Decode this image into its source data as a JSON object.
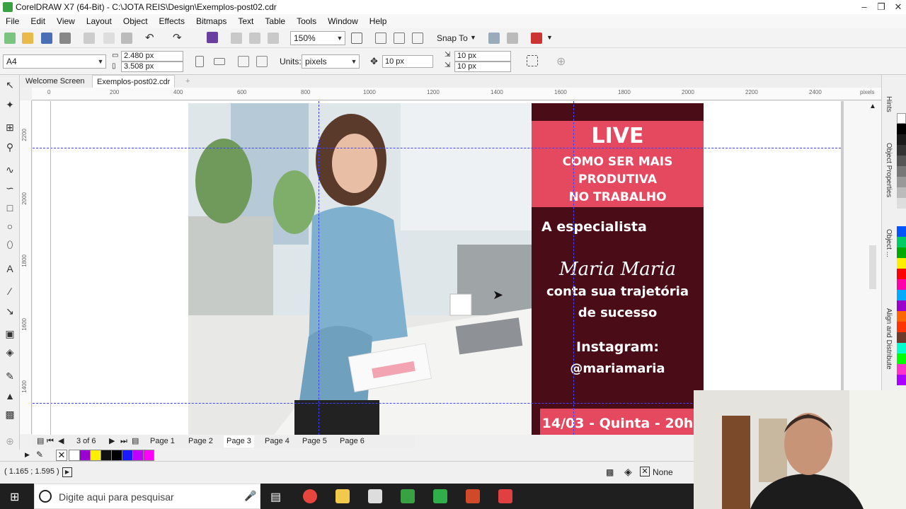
{
  "window": {
    "title": "CorelDRAW X7 (64-Bit) - C:\\JOTA REIS\\Design\\Exemplos-post02.cdr"
  },
  "menu": [
    "File",
    "Edit",
    "View",
    "Layout",
    "Object",
    "Effects",
    "Bitmaps",
    "Text",
    "Table",
    "Tools",
    "Window",
    "Help"
  ],
  "toolbar": {
    "zoom": "150%",
    "snap_to": "Snap To"
  },
  "property_bar": {
    "page_size": "A4",
    "width": "2.480 px",
    "height": "3.508 px",
    "units_label": "Units:",
    "units": "pixels",
    "nudge": "10 px",
    "dup_x": "10 px",
    "dup_y": "10 px"
  },
  "tabs": [
    "Welcome Screen",
    "Exemplos-post02.cdr"
  ],
  "ruler": {
    "h_ticks": [
      "0",
      "200",
      "400",
      "600",
      "800",
      "1000",
      "1200",
      "1400",
      "1600",
      "1800",
      "2000",
      "2200",
      "2400"
    ],
    "unit": "pixels",
    "v_ticks": [
      "2200",
      "2000",
      "1800",
      "1600",
      "1400"
    ]
  },
  "design": {
    "live": "LIVE",
    "headline": [
      "COMO SER MAIS",
      "PRODUTIVA",
      "NO TRABALHO"
    ],
    "specialist": "A especialista",
    "name": "Maria Maria",
    "subtitle": [
      "conta sua trajetória",
      "de sucesso"
    ],
    "instagram_label": "Instagram:",
    "instagram_handle": "@mariamaria",
    "date": "14/03 - Quinta - 20h",
    "accent": "#e5495f",
    "panel_bg": "#4a0d17"
  },
  "page_nav": {
    "counter": "3 of 6",
    "pages": [
      "Page 1",
      "Page 2",
      "Page 3",
      "Page 4",
      "Page 5",
      "Page 6"
    ],
    "active": "Page 3"
  },
  "status": {
    "coords": "( 1.165 ; 1.595 )",
    "fill": "None"
  },
  "dockers": [
    "Hints",
    "Object Properties",
    "Object ...",
    "Align and Distribute"
  ],
  "taskbar": {
    "search_placeholder": "Digite aqui para pesquisar"
  }
}
